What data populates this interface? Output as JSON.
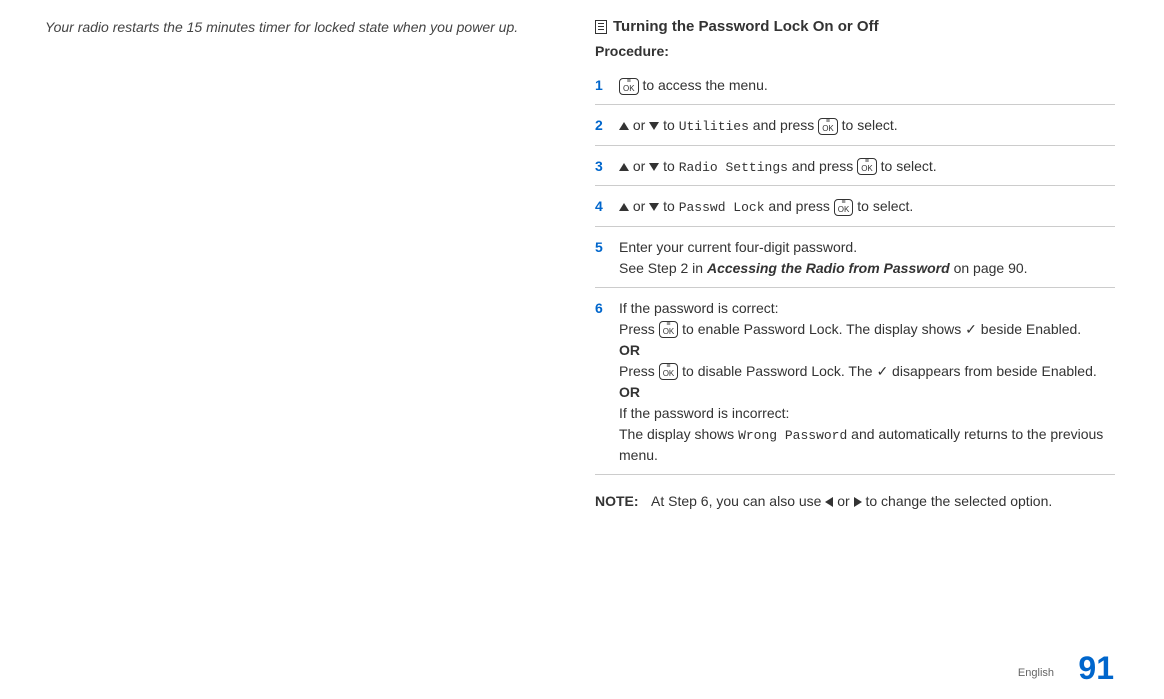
{
  "left": {
    "note": "Your radio restarts the 15 minutes timer for locked state when you power up."
  },
  "right": {
    "title": "Turning the Password Lock On or Off",
    "procedure_label": "Procedure:",
    "steps": {
      "s1": {
        "num": "1",
        "after_ok": " to access the menu."
      },
      "s2": {
        "num": "2",
        "or": " or ",
        "to": " to ",
        "menu": "Utilities",
        "and_press": " and press ",
        "select": " to select."
      },
      "s3": {
        "num": "3",
        "or": " or ",
        "to": " to ",
        "menu": "Radio Settings",
        "and_press": " and press ",
        "select": " to select."
      },
      "s4": {
        "num": "4",
        "or": " or ",
        "to": " to ",
        "menu": "Passwd Lock",
        "and_press": " and press ",
        "select": " to select."
      },
      "s5": {
        "num": "5",
        "line1": "Enter your current four-digit password.",
        "line2a": "See Step 2 in ",
        "line2b": "Accessing the Radio from Password",
        "line2c": " on page 90."
      },
      "s6": {
        "num": "6",
        "intro": "If the password is correct:",
        "press": " Press ",
        "enable": " to enable Password Lock. The display shows ",
        "check": "✓",
        "beside": " beside Enabled.",
        "or": "OR",
        "press2": "Press ",
        "disable": " to disable Password Lock. The ",
        "disappears": " disappears from beside Enabled.",
        "incorrect": "If the password is incorrect:",
        "wrong1": "The display shows ",
        "wrong_msg": "Wrong Password",
        "wrong2": " and automatically returns to the previous menu."
      }
    },
    "note": {
      "label": "NOTE:",
      "text1": "At Step 6, you can also use ",
      "or": " or ",
      "text2": " to change the selected option."
    }
  },
  "footer": {
    "english": "English",
    "page": "91"
  },
  "ok_label": "OK"
}
